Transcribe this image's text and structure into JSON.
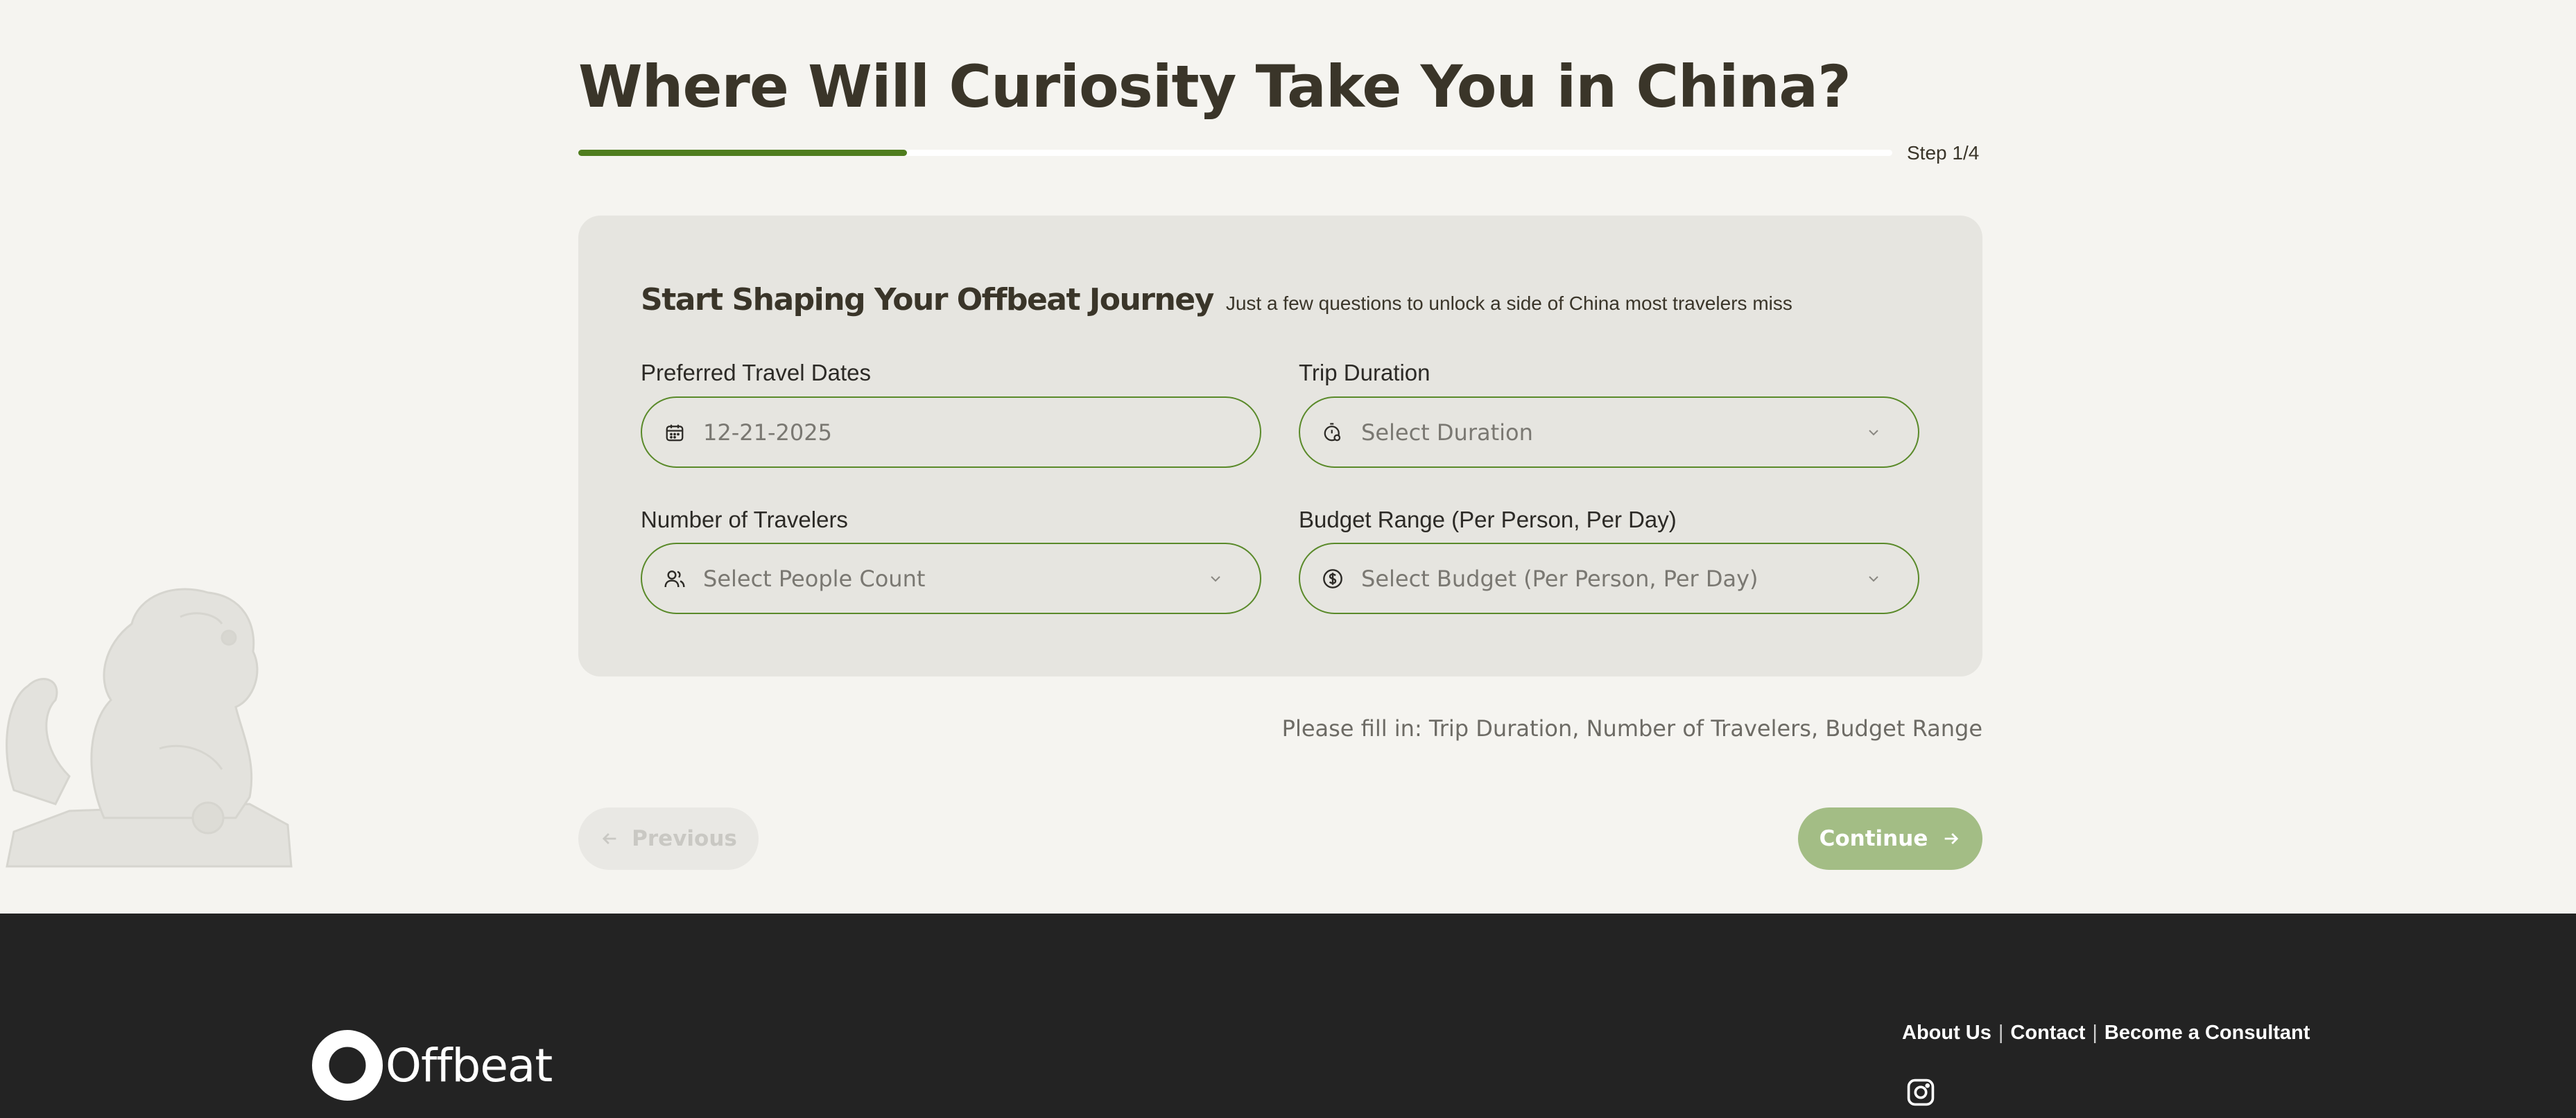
{
  "page": {
    "title": "Where Will Curiosity Take You in China?",
    "step_label": "Step 1/4",
    "progress_fraction": 0.25
  },
  "card": {
    "title": "Start Shaping Your Offbeat Journey",
    "subtitle": "Just a few questions to unlock a side of China most travelers miss",
    "fields": {
      "dates": {
        "label": "Preferred Travel Dates",
        "value": "12-21-2025",
        "icon": "calendar-icon"
      },
      "duration": {
        "label": "Trip Duration",
        "placeholder": "Select Duration",
        "icon": "stopwatch-icon"
      },
      "travelers": {
        "label": "Number of Travelers",
        "placeholder": "Select People Count",
        "icon": "people-icon"
      },
      "budget": {
        "label": "Budget Range (Per Person, Per Day)",
        "placeholder": "Select Budget (Per Person, Per Day)",
        "icon": "dollar-icon"
      }
    }
  },
  "validation_message": "Please fill in: Trip Duration, Number of Travelers, Budget Range",
  "buttons": {
    "previous": "Previous",
    "continue": "Continue"
  },
  "footer": {
    "logo_text": "Offbeat",
    "links": [
      "About Us",
      "Contact",
      "Become a Consultant"
    ],
    "social_icon": "instagram-icon"
  },
  "colors": {
    "accent_green": "#4f7d1e",
    "field_border": "#5a8a2a",
    "continue_bg": "#a3bd85",
    "footer_bg": "#232323",
    "page_bg": "#f5f4f0",
    "card_bg": "#e6e5e0"
  }
}
